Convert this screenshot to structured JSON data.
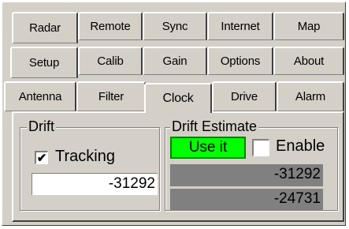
{
  "tabs": {
    "row1": [
      "Radar",
      "Remote",
      "Sync",
      "Internet",
      "Map"
    ],
    "row2": [
      "Setup",
      "Calib",
      "Gain",
      "Options",
      "About"
    ],
    "row3": [
      "Antenna",
      "Filter",
      "Clock",
      "Drive",
      "Alarm"
    ],
    "active": "Clock"
  },
  "drift": {
    "title": "Drift",
    "tracking_label": "Tracking",
    "tracking_checked": "✔",
    "value": "-31292"
  },
  "drift_estimate": {
    "title": "Drift Estimate",
    "use_it_label": "Use it",
    "enable_label": "Enable",
    "enable_checked": "",
    "estimate1": "-31292",
    "estimate2": "-24731"
  },
  "colors": {
    "use_it_button": "#00ff00",
    "readonly_field": "#808080",
    "face": "#d4d0c8"
  }
}
